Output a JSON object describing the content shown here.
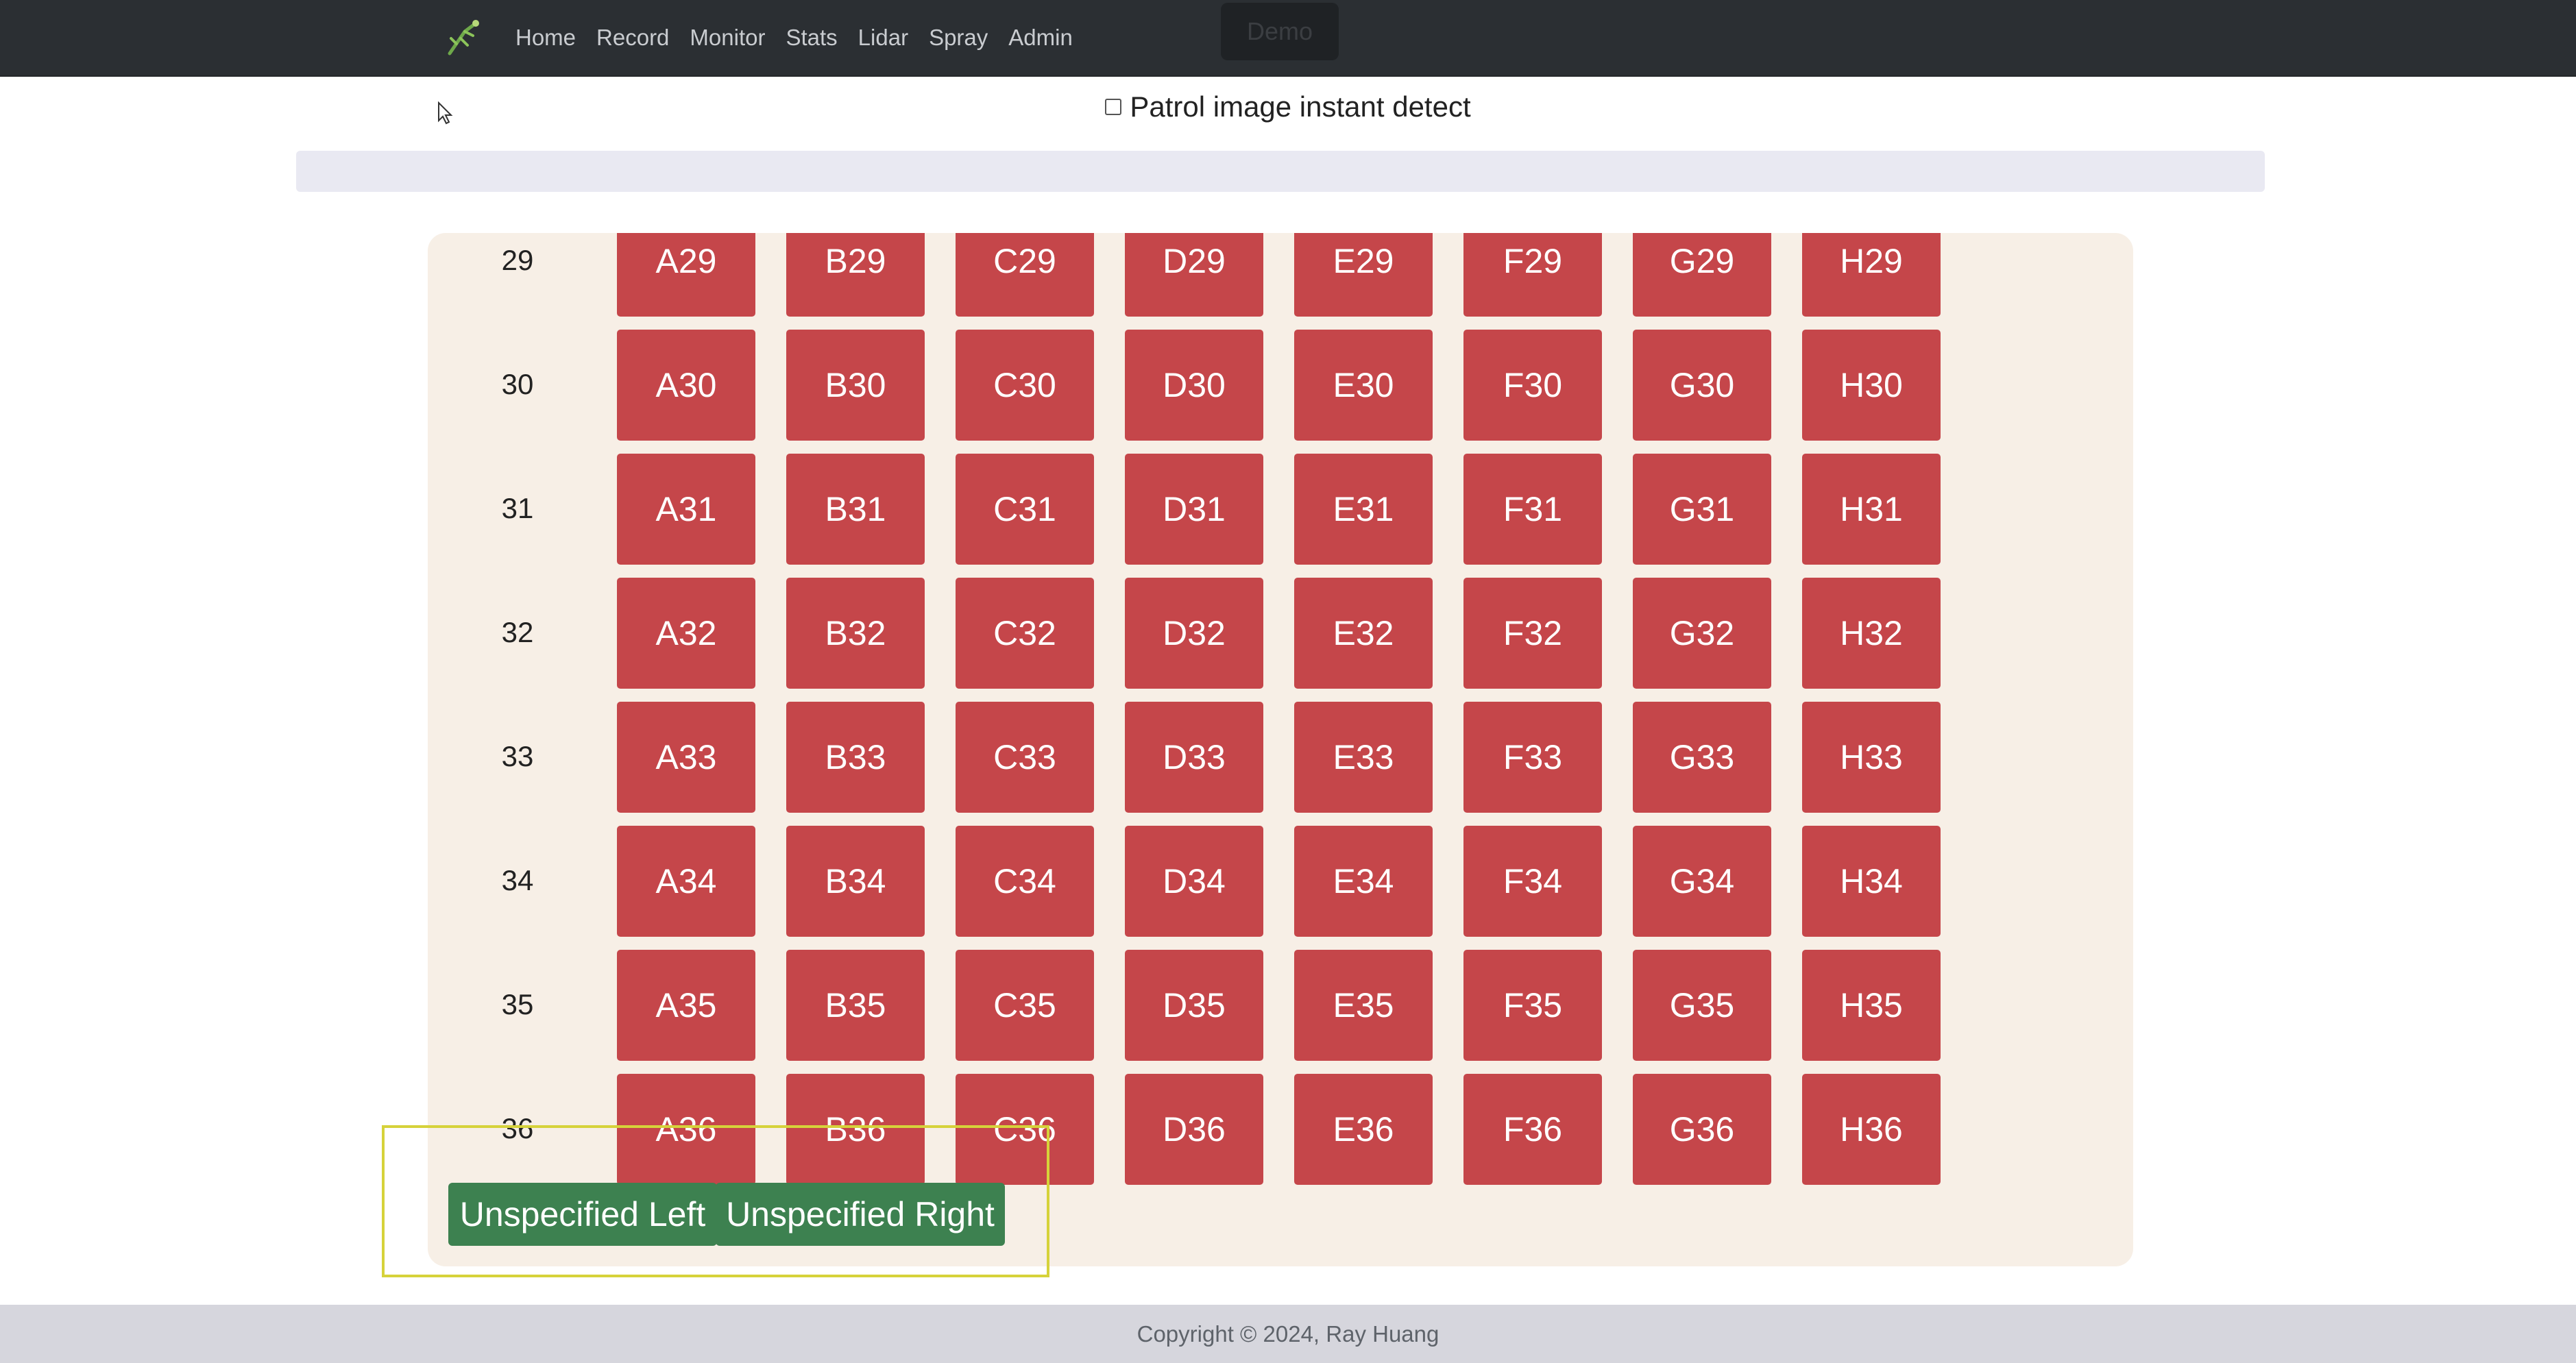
{
  "nav": {
    "links": [
      "Home",
      "Record",
      "Monitor",
      "Stats",
      "Lidar",
      "Spray",
      "Admin"
    ],
    "demo_label": "Demo"
  },
  "patrol": {
    "label": "Patrol image instant detect",
    "checked": false
  },
  "progress": {
    "percent": 0
  },
  "grid": {
    "columns": [
      "A",
      "B",
      "C",
      "D",
      "E",
      "F",
      "G",
      "H"
    ],
    "rows": [
      "29",
      "30",
      "31",
      "32",
      "33",
      "34",
      "35",
      "36"
    ],
    "cell_color": "#c5464a"
  },
  "unspecified": {
    "left": "Unspecified Left",
    "right": "Unspecified Right",
    "color": "#3d8150"
  },
  "footer": {
    "text": "Copyright © 2024, Ray Huang"
  }
}
